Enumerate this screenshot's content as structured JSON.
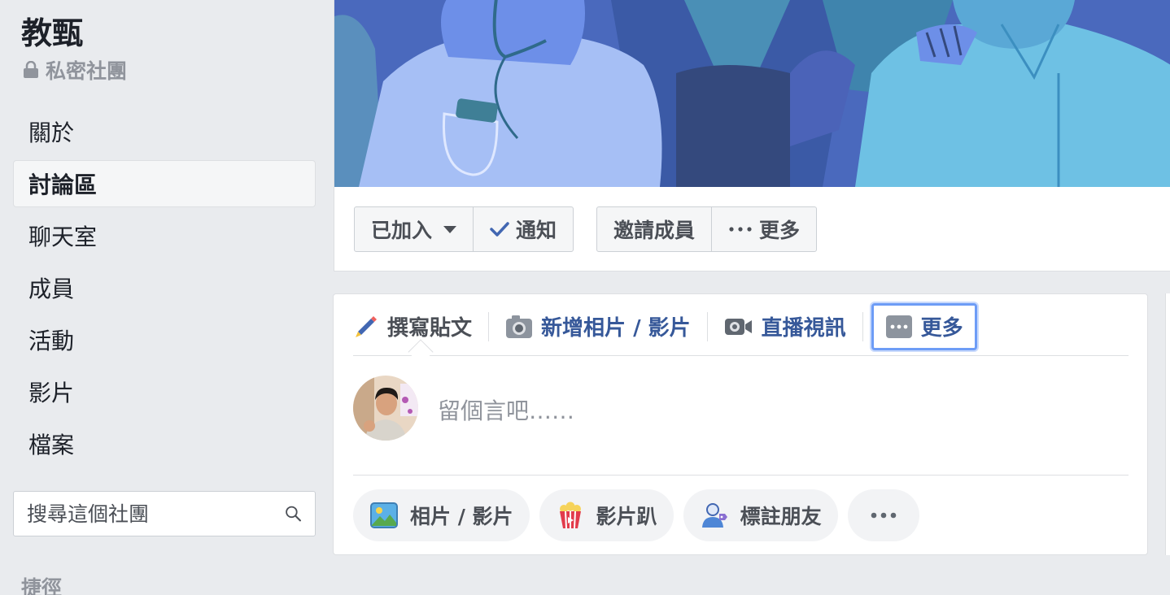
{
  "group": {
    "title": "教甄",
    "privacy": "私密社團",
    "privacy_icon": "lock-icon"
  },
  "sidebar": {
    "items": [
      {
        "label": "關於",
        "active": false
      },
      {
        "label": "討論區",
        "active": true
      },
      {
        "label": "聊天室",
        "active": false
      },
      {
        "label": "成員",
        "active": false
      },
      {
        "label": "活動",
        "active": false
      },
      {
        "label": "影片",
        "active": false
      },
      {
        "label": "檔案",
        "active": false
      }
    ],
    "search_placeholder": "搜尋這個社團",
    "shortcuts_heading": "捷徑"
  },
  "header_actions": {
    "joined_label": "已加入",
    "notify_label": "通知",
    "invite_label": "邀請成員",
    "more_label": "更多"
  },
  "composer": {
    "tabs": [
      {
        "label": "撰寫貼文",
        "icon": "pencil-icon"
      },
      {
        "label": "新增相片 / 影片",
        "icon": "camera-icon"
      },
      {
        "label": "直播視訊",
        "icon": "video-camera-icon"
      },
      {
        "label": "更多",
        "icon": "more-dots-icon"
      }
    ],
    "placeholder": "留個言吧……",
    "chips": [
      {
        "label": "相片 / 影片",
        "icon": "photo-icon"
      },
      {
        "label": "影片趴",
        "icon": "popcorn-icon"
      },
      {
        "label": "標註朋友",
        "icon": "tag-friends-icon"
      }
    ]
  },
  "colors": {
    "page_bg": "#e9ebee",
    "link_blue": "#365899",
    "focus_ring": "#6d9cf6",
    "cover_bg": "#4b6cc1"
  }
}
